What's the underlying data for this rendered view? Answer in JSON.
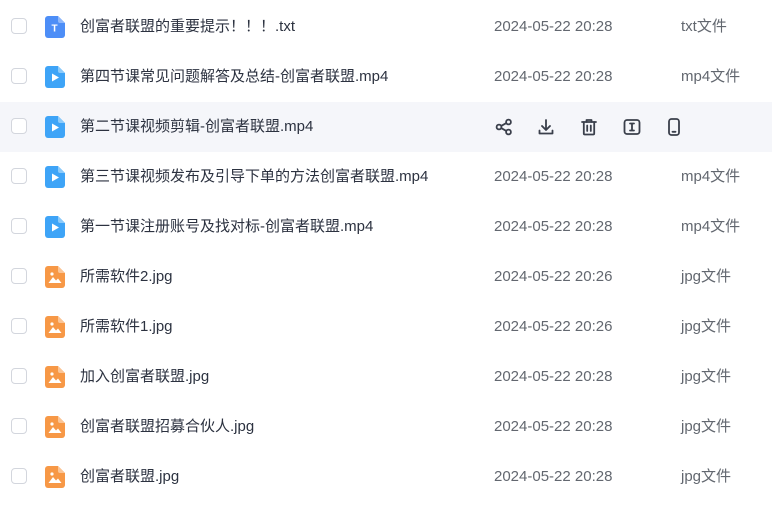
{
  "files": [
    {
      "name": "创富者联盟的重要提示！！！.txt",
      "time": "2024-05-22 20:28",
      "type": "txt文件",
      "icon": "txt-file-icon",
      "icon_letter": "T"
    },
    {
      "name": "第四节课常见问题解答及总结-创富者联盟.mp4",
      "time": "2024-05-22 20:28",
      "type": "mp4文件",
      "icon": "video-file-icon"
    },
    {
      "name": "第二节课视频剪辑-创富者联盟.mp4",
      "time": "",
      "type": "",
      "icon": "video-file-icon",
      "hovered": true
    },
    {
      "name": "第三节课视频发布及引导下单的方法创富者联盟.mp4",
      "time": "2024-05-22 20:28",
      "type": "mp4文件",
      "icon": "video-file-icon"
    },
    {
      "name": "第一节课注册账号及找对标-创富者联盟.mp4",
      "time": "2024-05-22 20:28",
      "type": "mp4文件",
      "icon": "video-file-icon"
    },
    {
      "name": "所需软件2.jpg",
      "time": "2024-05-22 20:26",
      "type": "jpg文件",
      "icon": "image-file-icon"
    },
    {
      "name": "所需软件1.jpg",
      "time": "2024-05-22 20:26",
      "type": "jpg文件",
      "icon": "image-file-icon"
    },
    {
      "name": "加入创富者联盟.jpg",
      "time": "2024-05-22 20:28",
      "type": "jpg文件",
      "icon": "image-file-icon"
    },
    {
      "name": "创富者联盟招募合伙人.jpg",
      "time": "2024-05-22 20:28",
      "type": "jpg文件",
      "icon": "image-file-icon"
    },
    {
      "name": "创富者联盟.jpg",
      "time": "2024-05-22 20:28",
      "type": "jpg文件",
      "icon": "image-file-icon"
    }
  ],
  "hover_actions": [
    "share-icon",
    "download-icon",
    "delete-icon",
    "rename-icon",
    "phone-icon"
  ],
  "colors": {
    "txt_icon": "#4d8ef7",
    "video_icon": "#3ea4f7",
    "image_icon": "#f79846",
    "hover_bg": "#f5f6fa",
    "action_icon": "#3a3f4b"
  }
}
